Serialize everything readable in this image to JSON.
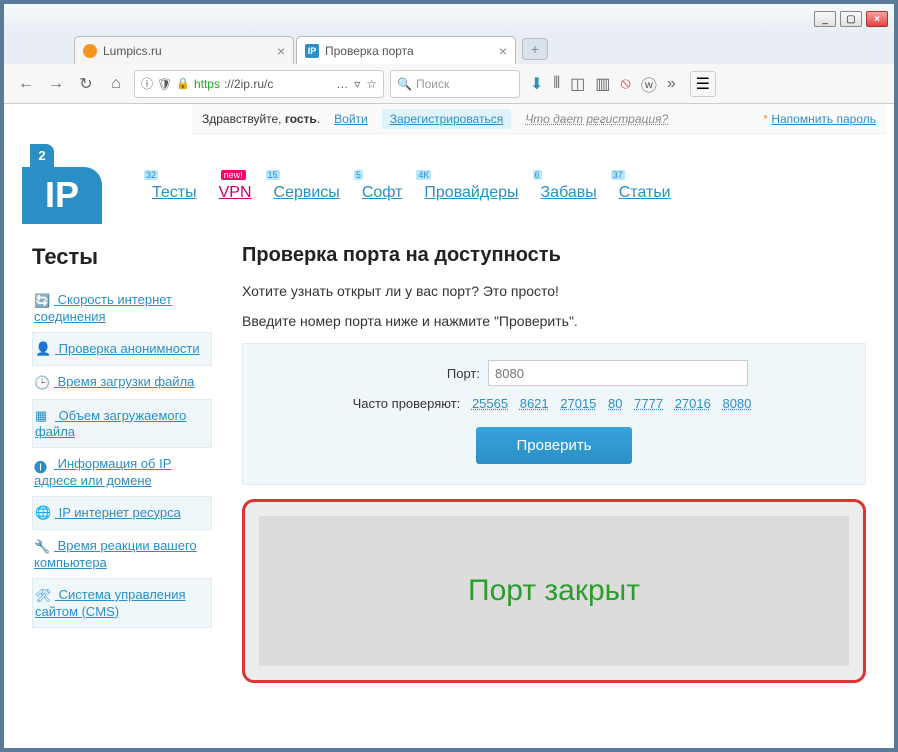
{
  "window": {
    "min": "_",
    "max": "▢",
    "close": "×"
  },
  "tabs": {
    "t1": "Lumpics.ru",
    "t2": "Проверка порта",
    "t2icon": "IP"
  },
  "url": {
    "prefix": "https",
    "host": "://2ip.ru/c"
  },
  "search": {
    "placeholder": "Поиск",
    "icon": "🔍"
  },
  "auth": {
    "greet1": "Здравствуйте, ",
    "greet2": "гость",
    "login": "Войти",
    "register": "Зарегистрироваться",
    "what": "Что дает регистрация?",
    "remind": "Напомнить пароль"
  },
  "logo": {
    "top": "2",
    "main": "IP"
  },
  "nav": [
    {
      "label": "Тесты",
      "badge": "32"
    },
    {
      "label": "VPN",
      "new": "new!"
    },
    {
      "label": "Сервисы",
      "badge": "15"
    },
    {
      "label": "Софт",
      "badge": "5"
    },
    {
      "label": "Провайдеры",
      "badge": "4K"
    },
    {
      "label": "Забавы",
      "badge": "6"
    },
    {
      "label": "Статьи",
      "badge": "37"
    }
  ],
  "sidebar": {
    "title": "Тесты",
    "items": [
      "Скорость интернет соединения",
      "Проверка анонимности",
      "Время загрузки файла",
      "Объем загружаемого файла",
      "Информация об IP адресе или домене",
      "IP интернет ресурса",
      "Время реакции вашего компьютера",
      "Система управления сайтом (CMS)"
    ]
  },
  "main": {
    "h1": "Проверка порта на доступность",
    "p1": "Хотите узнать открыт ли у вас порт? Это просто!",
    "p2": "Введите номер порта ниже и нажмите \"Проверить\".",
    "portlabel": "Порт:",
    "portplaceholder": "8080",
    "oftenlabel": "Часто проверяют:",
    "oftenports": [
      "25565",
      "8621",
      "27015",
      "80",
      "7777",
      "27016",
      "8080"
    ],
    "checkbtn": "Проверить",
    "result": "Порт закрыт"
  }
}
